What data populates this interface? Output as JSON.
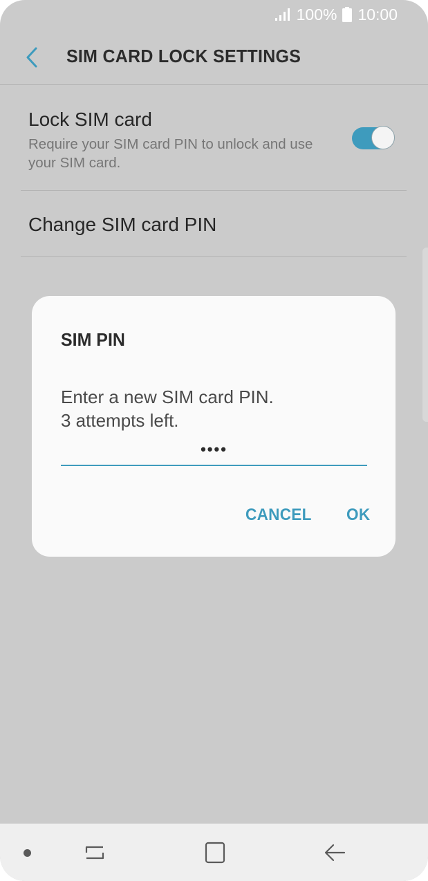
{
  "status_bar": {
    "battery": "100%",
    "time": "10:00",
    "icons": [
      "signal-icon",
      "battery-icon"
    ]
  },
  "header": {
    "title": "SIM CARD LOCK SETTINGS",
    "back_icon": "chevron-left-icon"
  },
  "settings": {
    "lock_sim": {
      "title": "Lock SIM card",
      "description": "Require your SIM card PIN to unlock and use your SIM card.",
      "toggle_on": true
    },
    "change_pin": {
      "title": "Change SIM card PIN"
    }
  },
  "dialog": {
    "title": "SIM PIN",
    "message_line1": "Enter a new SIM card PIN.",
    "message_line2": "3 attempts left.",
    "pin_value": "••••",
    "cancel_label": "CANCEL",
    "ok_label": "OK"
  },
  "nav_bar": {
    "icons": [
      "dot-icon",
      "recent-apps-icon",
      "home-icon",
      "back-arrow-icon"
    ]
  },
  "colors": {
    "accent": "#3e9bbd",
    "background_dim": "#cbcbcb",
    "dialog_bg": "#fafafa",
    "nav_bg": "#efefef"
  }
}
